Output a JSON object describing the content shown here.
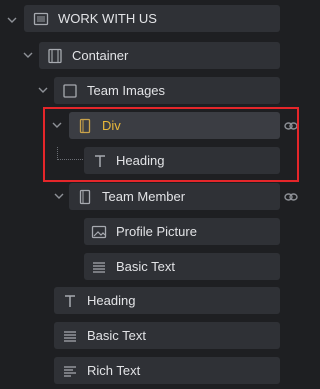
{
  "tree": {
    "work_with_us": {
      "label": "WORK WITH US",
      "icon": "section-icon"
    },
    "container": {
      "label": "Container",
      "icon": "container-icon"
    },
    "team_images": {
      "label": "Team Images",
      "icon": "block-icon"
    },
    "div": {
      "label": "Div",
      "icon": "div-icon"
    },
    "heading_1": {
      "label": "Heading",
      "icon": "text-heading-icon"
    },
    "team_member": {
      "label": "Team Member",
      "icon": "div-icon"
    },
    "profile_picture": {
      "label": "Profile Picture",
      "icon": "image-icon"
    },
    "basic_text_1": {
      "label": "Basic Text",
      "icon": "text-lines-icon"
    },
    "heading_2": {
      "label": "Heading",
      "icon": "text-heading-icon"
    },
    "basic_text_2": {
      "label": "Basic Text",
      "icon": "text-lines-icon"
    },
    "rich_text": {
      "label": "Rich Text",
      "icon": "rich-text-icon"
    }
  },
  "colors": {
    "background": "#1e1f22",
    "row": "#2f3136",
    "selected_row": "#3b3d43",
    "selected_label": "#e8b83a",
    "highlight_border": "#e5262a"
  }
}
